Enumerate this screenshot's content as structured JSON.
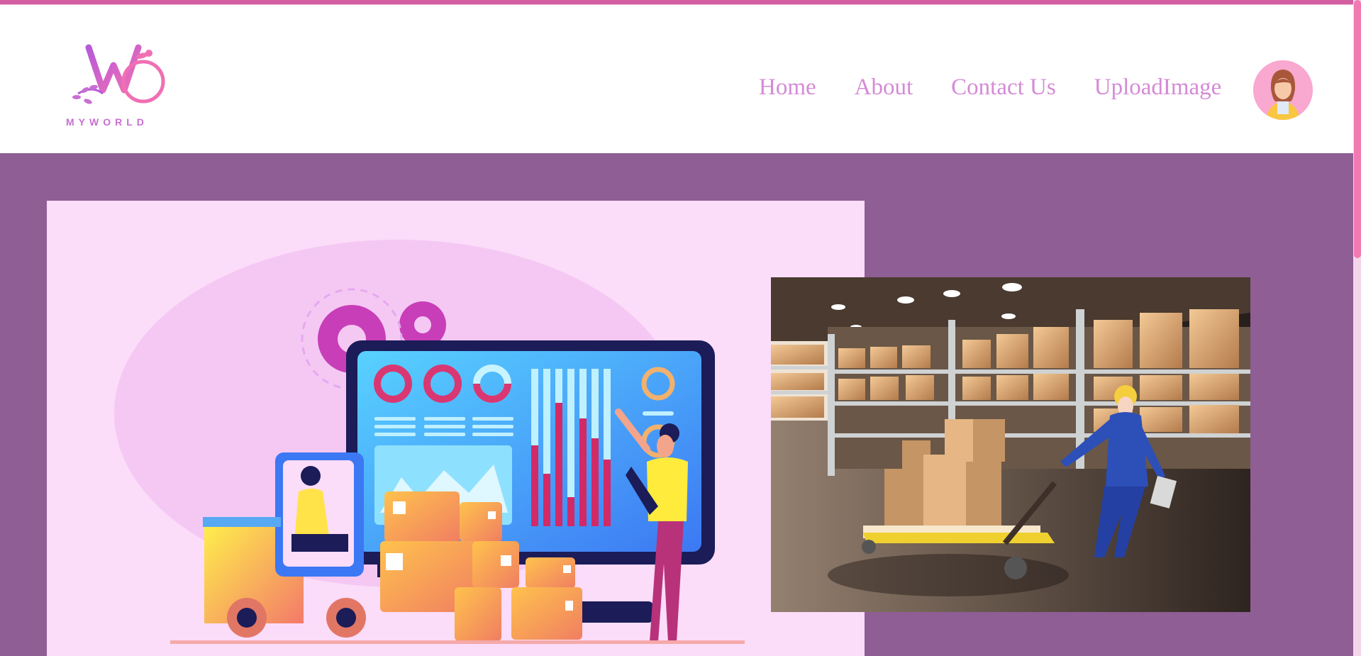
{
  "brand": {
    "logo_text": "MYWORLD"
  },
  "nav": {
    "items": [
      "Home",
      "About",
      "Contact Us",
      "UploadImage"
    ]
  },
  "colors": {
    "page_background": "#8e5e94",
    "header_background": "#ffffff",
    "nav_text": "#d58ad6",
    "accent_pink": "#f27ab3",
    "hero_background": "#fbdcf9"
  },
  "icons": {
    "logo": "myworld-logo-icon",
    "avatar": "user-avatar-icon"
  }
}
